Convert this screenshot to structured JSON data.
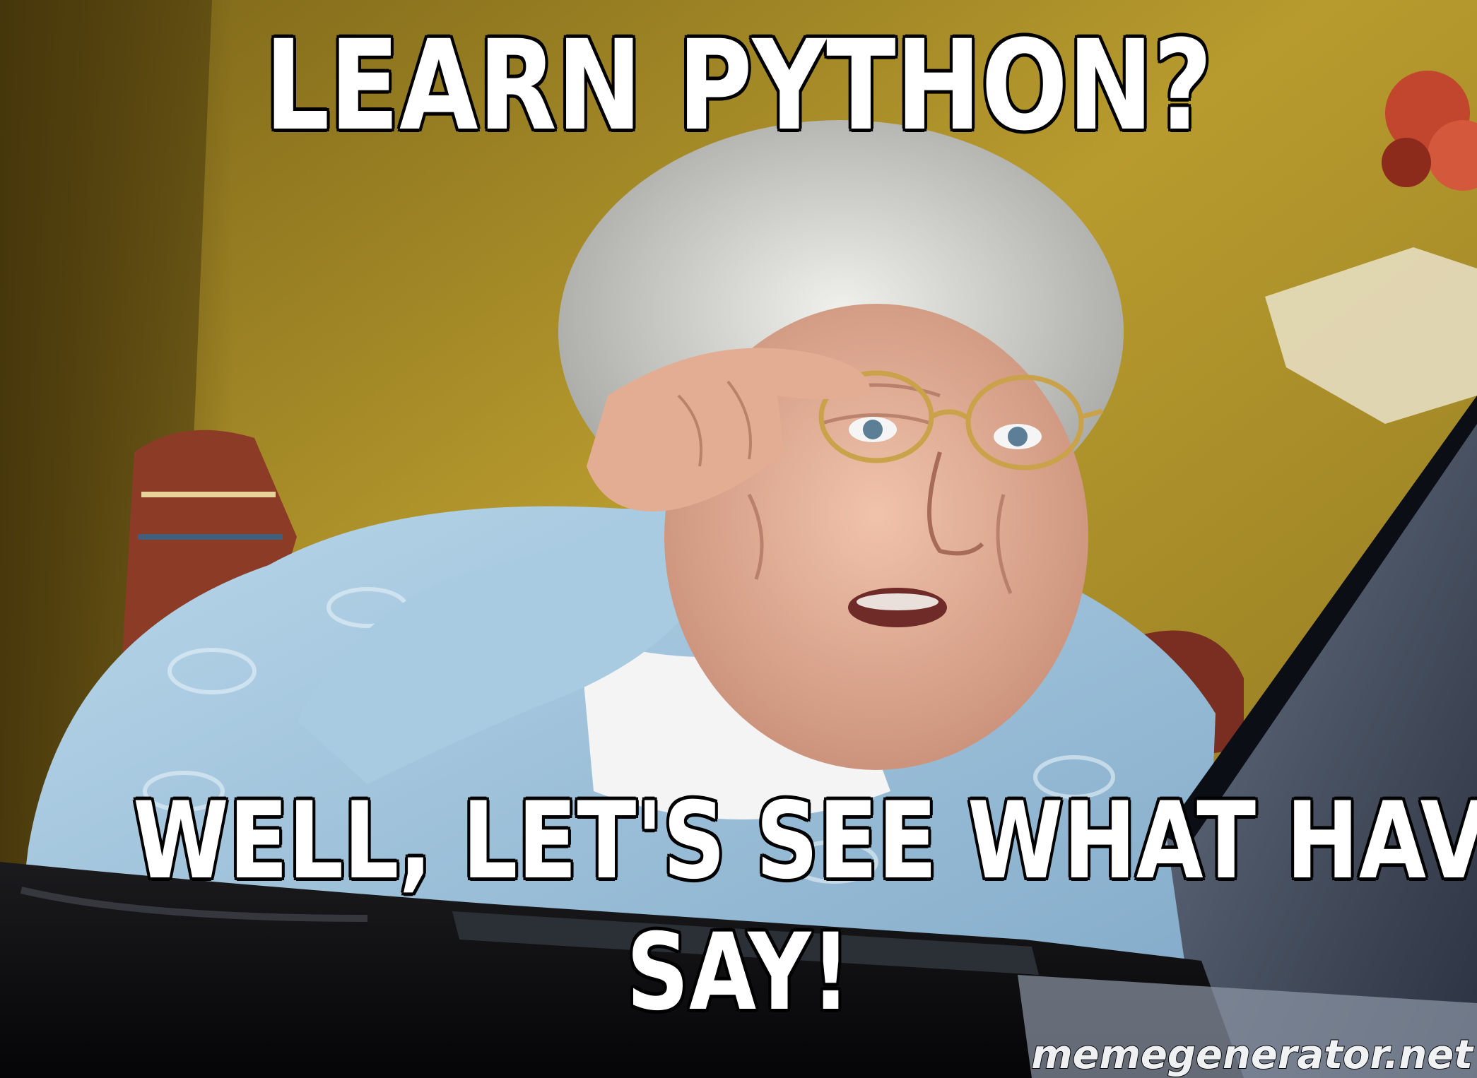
{
  "meme": {
    "top_text": "LEARN PYTHON?",
    "bottom_text_line1": "WELL, LET'S SEE WHAT HAVE TO",
    "bottom_text_line2": "SAY!",
    "watermark": "memegenerator.net"
  },
  "colors": {
    "wall": "#b59a2c",
    "shadow": "#3a2a08",
    "cardigan": "#9fc6df",
    "skin": "#e6b29a",
    "hair": "#d8d8d4",
    "laptop": "#1c2330",
    "caption_fill": "#ffffff",
    "caption_stroke": "#000000"
  }
}
